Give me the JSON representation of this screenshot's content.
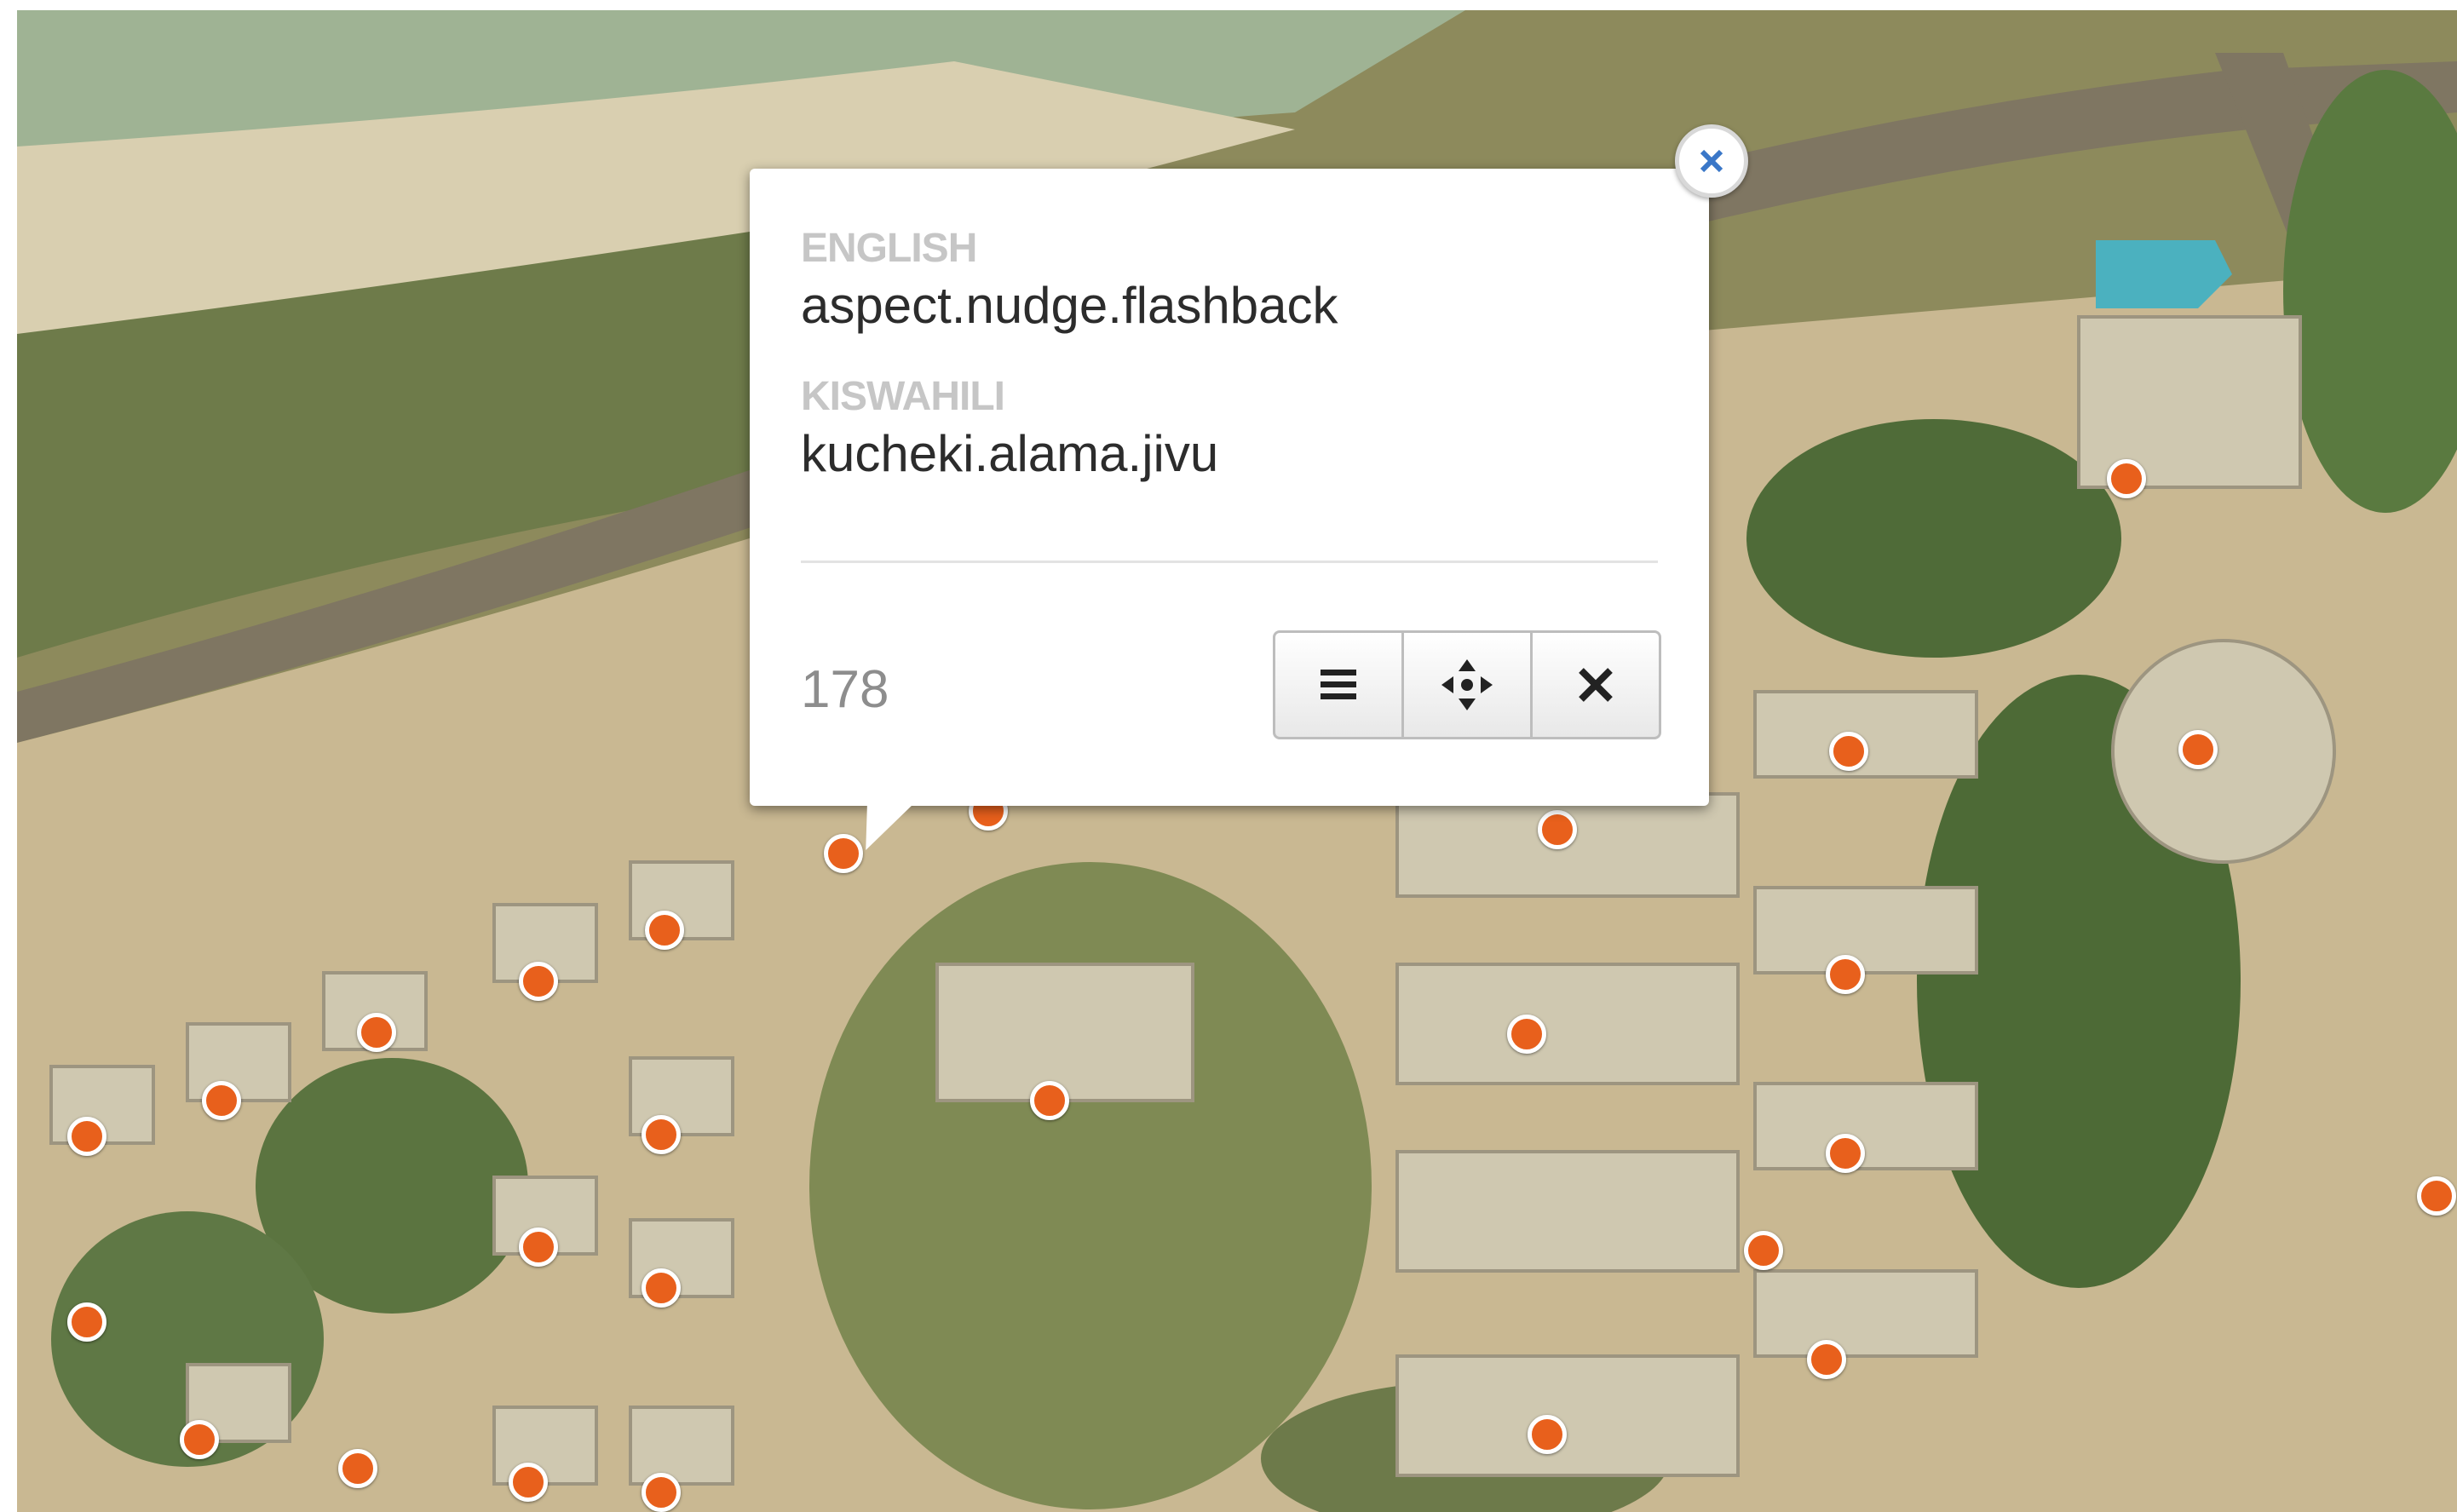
{
  "popup": {
    "fields": [
      {
        "label": "ENGLISH",
        "value": "aspect.nudge.flashback"
      },
      {
        "label": "KISWAHILI",
        "value": "kucheki.alama.jivu"
      }
    ],
    "count": "178",
    "actions": [
      {
        "icon": "list-icon",
        "action": "details"
      },
      {
        "icon": "move-icon",
        "action": "move"
      },
      {
        "icon": "close-icon",
        "action": "delete"
      }
    ],
    "close_icon": "close-icon"
  },
  "map": {
    "basemap": "satellite",
    "marker_color": "#e8601c",
    "marker_count": 37
  }
}
